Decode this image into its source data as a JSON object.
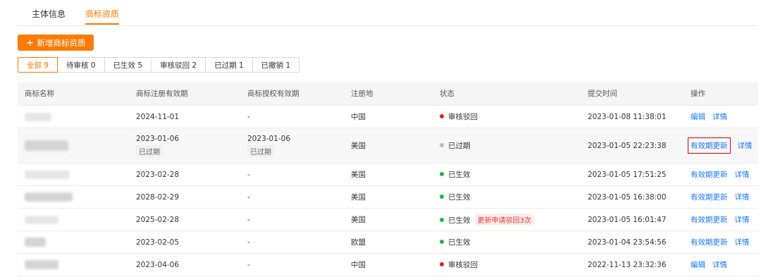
{
  "tabs": [
    {
      "label": "主体信息",
      "active": false
    },
    {
      "label": "商标资质",
      "active": true
    }
  ],
  "add_button": {
    "label": "新增商标资质"
  },
  "filters": [
    {
      "label": "全部 9",
      "active": true
    },
    {
      "label": "待审核 0",
      "active": false
    },
    {
      "label": "已生效 5",
      "active": false
    },
    {
      "label": "审核驳回 2",
      "active": false
    },
    {
      "label": "已过期 1",
      "active": false
    },
    {
      "label": "已撤销 1",
      "active": false
    }
  ],
  "columns": [
    "商标名称",
    "商标注册有效期",
    "商标授权有效期",
    "注册地",
    "状态",
    "提交时间",
    "操作"
  ],
  "status_colors": {
    "审核驳回": "#e02020",
    "已过期": "#bbbbbb",
    "已生效": "#27b148"
  },
  "rows": [
    {
      "reg_date": "2024-11-01",
      "auth_date": "-",
      "region": "中国",
      "status": "审核驳回",
      "submit_time": "2023-01-08 11:38:01",
      "actions": [
        "编辑",
        "详情"
      ]
    },
    {
      "reg_date": "2023-01-06",
      "reg_tag": "已过期",
      "auth_date": "2023-01-06",
      "auth_tag": "已过期",
      "region": "美国",
      "status": "已过期",
      "submit_time": "2023-01-05 22:23:38",
      "actions": [
        "有效期更新",
        "详情"
      ]
    },
    {
      "reg_date": "2023-02-28",
      "auth_date": "-",
      "region": "美国",
      "status": "已生效",
      "submit_time": "2023-01-05 17:51:25",
      "actions": [
        "有效期更新",
        "详情"
      ]
    },
    {
      "reg_date": "2028-02-29",
      "auth_date": "-",
      "region": "美国",
      "status": "已生效",
      "submit_time": "2023-01-05 16:38:00",
      "actions": [
        "有效期更新",
        "详情"
      ]
    },
    {
      "reg_date": "2025-02-28",
      "auth_date": "-",
      "region": "美国",
      "status": "已生效",
      "status_badge": "更新申请驳回3次",
      "submit_time": "2023-01-05 16:01:47",
      "actions": [
        "有效期更新",
        "详情"
      ]
    },
    {
      "reg_date": "2023-02-05",
      "auth_date": "-",
      "region": "欧盟",
      "status": "已生效",
      "submit_time": "2023-01-04 23:54:56",
      "actions": [
        "有效期更新",
        "详情"
      ]
    },
    {
      "reg_date": "2023-04-06",
      "auth_date": "-",
      "region": "中国",
      "status": "审核驳回",
      "submit_time": "2022-11-13 23:32:36",
      "actions": [
        "编辑",
        "详情"
      ]
    }
  ]
}
